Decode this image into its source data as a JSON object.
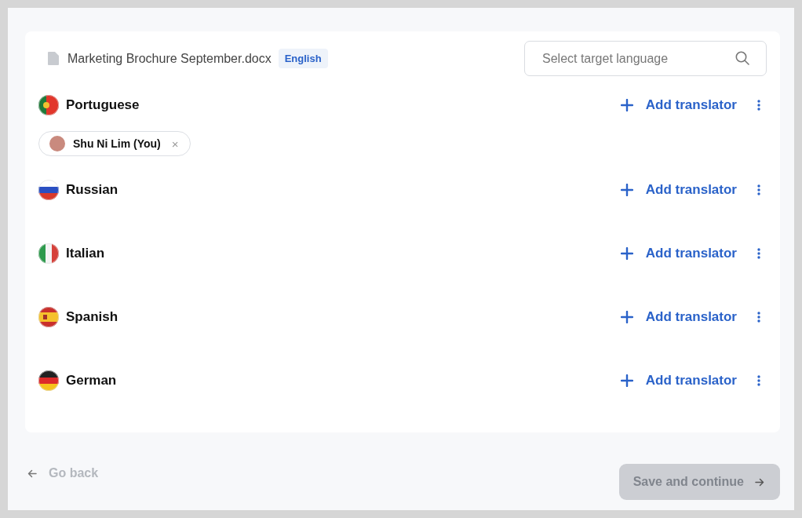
{
  "document": {
    "name": "Marketing Brochure September.docx",
    "source_language": "English"
  },
  "search": {
    "placeholder": "Select target language"
  },
  "languages": [
    {
      "name": "Portuguese",
      "kind": "pt",
      "action": "Add translator",
      "translators": [
        {
          "name": "Shu Ni Lim (You)",
          "remove": "×"
        }
      ]
    },
    {
      "name": "Russian",
      "kind": "ru",
      "action": "Add translator"
    },
    {
      "name": "Italian",
      "kind": "it",
      "action": "Add translator"
    },
    {
      "name": "Spanish",
      "kind": "es",
      "action": "Add translator"
    },
    {
      "name": "German",
      "kind": "de",
      "action": "Add translator"
    }
  ],
  "footer": {
    "back": "Go back",
    "save": {
      "label": "Save and continue",
      "disabled": true
    }
  }
}
